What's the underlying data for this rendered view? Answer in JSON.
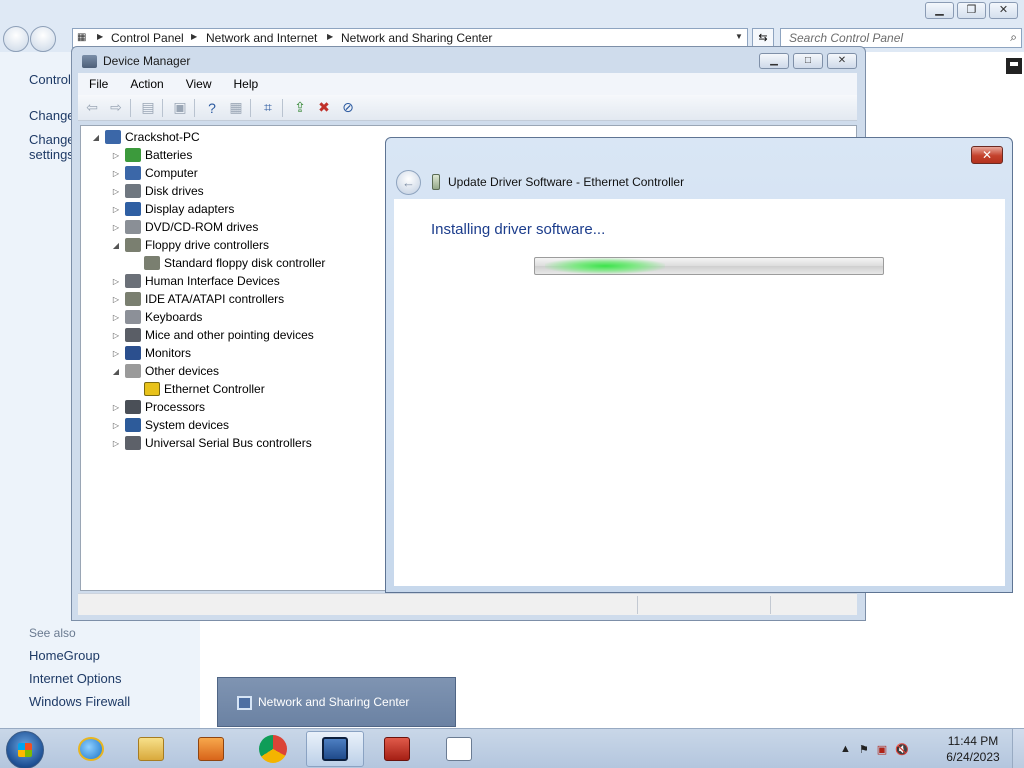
{
  "explorer": {
    "breadcrumb": [
      "Control Panel",
      "Network and Internet",
      "Network and Sharing Center"
    ],
    "search_placeholder": "Search Control Panel",
    "left_pane": {
      "control": "Control",
      "change1": "Change",
      "change2a": "Change",
      "change2b": "settings",
      "see_also": "See also",
      "homegroup": "HomeGroup",
      "internet_options": "Internet Options",
      "windows_firewall": "Windows Firewall"
    }
  },
  "device_manager": {
    "title": "Device Manager",
    "menu": [
      "File",
      "Action",
      "View",
      "Help"
    ],
    "tree": [
      {
        "label": "Crackshot-PC",
        "level": 0,
        "state": "expanded",
        "icon": "computer-icon"
      },
      {
        "label": "Batteries",
        "level": 1,
        "state": "collapsed",
        "icon": "battery-icon"
      },
      {
        "label": "Computer",
        "level": 1,
        "state": "collapsed",
        "icon": "computer-icon"
      },
      {
        "label": "Disk drives",
        "level": 1,
        "state": "collapsed",
        "icon": "disk-icon"
      },
      {
        "label": "Display adapters",
        "level": 1,
        "state": "collapsed",
        "icon": "display-icon"
      },
      {
        "label": "DVD/CD-ROM drives",
        "level": 1,
        "state": "collapsed",
        "icon": "dvd-icon"
      },
      {
        "label": "Floppy drive controllers",
        "level": 1,
        "state": "expanded",
        "icon": "controller-icon"
      },
      {
        "label": "Standard floppy disk controller",
        "level": 2,
        "state": "leaf",
        "icon": "controller-icon"
      },
      {
        "label": "Human Interface Devices",
        "level": 1,
        "state": "collapsed",
        "icon": "hid-icon"
      },
      {
        "label": "IDE ATA/ATAPI controllers",
        "level": 1,
        "state": "collapsed",
        "icon": "controller-icon"
      },
      {
        "label": "Keyboards",
        "level": 1,
        "state": "collapsed",
        "icon": "keyboard-icon"
      },
      {
        "label": "Mice and other pointing devices",
        "level": 1,
        "state": "collapsed",
        "icon": "mouse-icon"
      },
      {
        "label": "Monitors",
        "level": 1,
        "state": "collapsed",
        "icon": "monitor-icon"
      },
      {
        "label": "Other devices",
        "level": 1,
        "state": "expanded",
        "icon": "unknown-device-icon"
      },
      {
        "label": "Ethernet Controller",
        "level": 2,
        "state": "leaf",
        "icon": "warning-device-icon"
      },
      {
        "label": "Processors",
        "level": 1,
        "state": "collapsed",
        "icon": "processor-icon"
      },
      {
        "label": "System devices",
        "level": 1,
        "state": "collapsed",
        "icon": "system-icon"
      },
      {
        "label": "Universal Serial Bus controllers",
        "level": 1,
        "state": "collapsed",
        "icon": "usb-icon"
      }
    ]
  },
  "update_dialog": {
    "title": "Update Driver Software - Ethernet Controller",
    "heading": "Installing driver software...",
    "progress_state": "indeterminate"
  },
  "taskbar": {
    "popup_label": "Network and Sharing Center",
    "time": "11:44 PM",
    "date": "6/24/2023"
  },
  "colors": {
    "dialog_heading": "#1c3d8c",
    "progress_glow": "#3be34b",
    "close_button": "#c4412c"
  }
}
